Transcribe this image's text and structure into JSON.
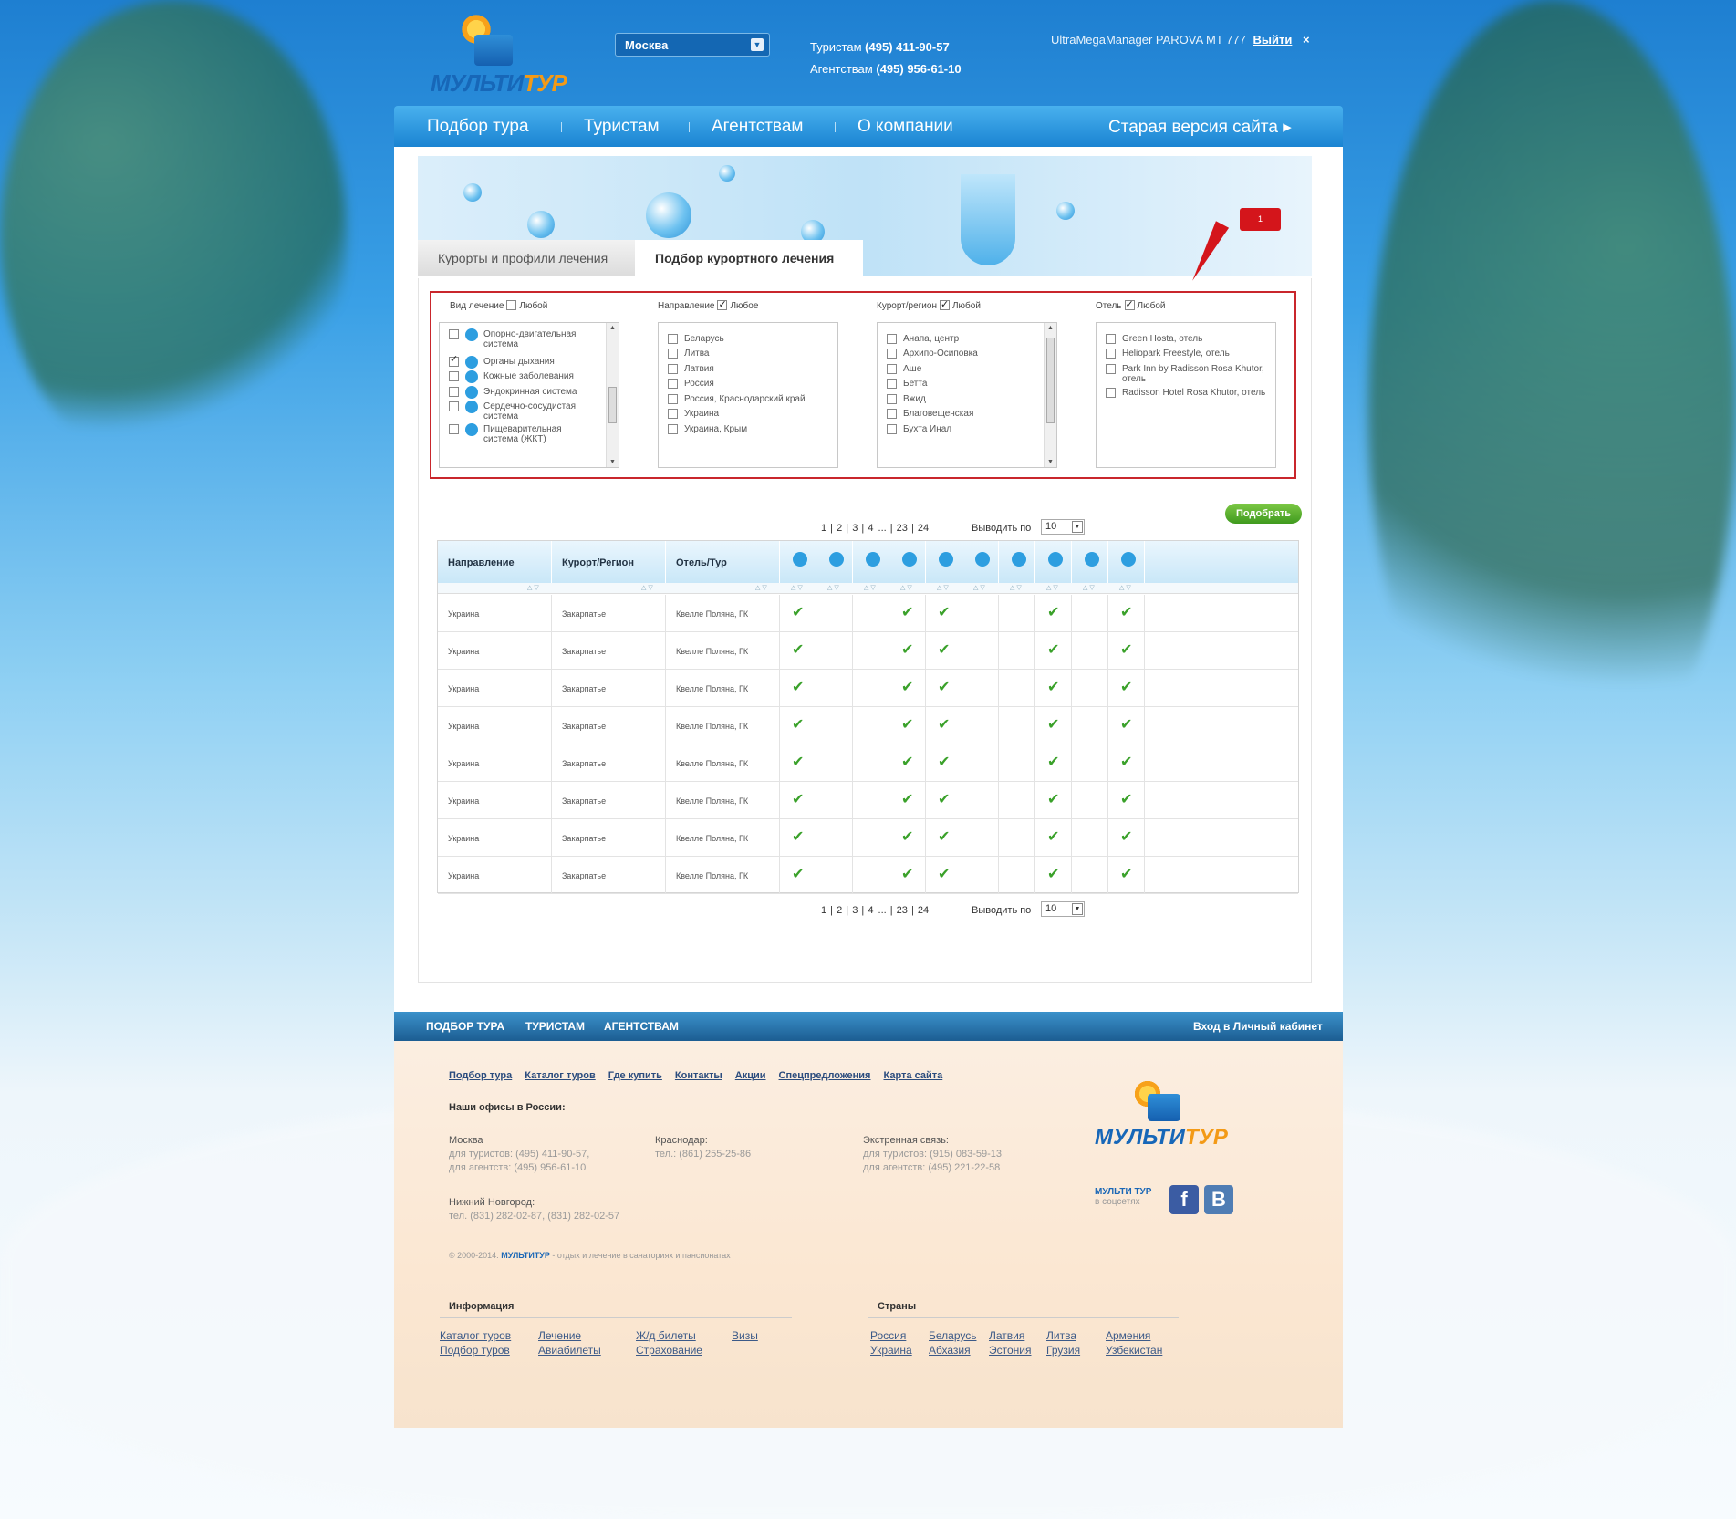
{
  "header": {
    "logo_text_a": "МУЛЬТИ",
    "logo_text_b": "ТУР",
    "city": "Москва",
    "phone_tourists_label": "Туристам",
    "phone_tourists": "(495) 411-90-57",
    "phone_agents_label": "Агентствам",
    "phone_agents": "(495) 956-61-10",
    "user": "UltraMegaManager PAROVA MT 777",
    "logout": "Выйти",
    "close": "×"
  },
  "nav": {
    "items": [
      "Подбор тура",
      "Туристам",
      "Агентствам",
      "О компании"
    ],
    "old_site": "Старая версия сайта ▸"
  },
  "tabs": [
    "Курорты и профили лечения",
    "Подбор курортного лечения"
  ],
  "annotation": "1",
  "filters": {
    "treatment": {
      "label": "Вид лечение",
      "any": "Любой",
      "any_checked": false,
      "items": [
        {
          "text": "Опорно-двигательная система",
          "checked": false
        },
        {
          "text": "Органы дыхания",
          "checked": true
        },
        {
          "text": "Кожные заболевания",
          "checked": false
        },
        {
          "text": "Эндокринная система",
          "checked": false
        },
        {
          "text": "Сердечно-сосудистая система",
          "checked": false
        },
        {
          "text": "Пищеварительная система (ЖКТ)",
          "checked": false
        }
      ]
    },
    "direction": {
      "label": "Направление",
      "any": "Любое",
      "any_checked": true,
      "items": [
        "Беларусь",
        "Литва",
        "Латвия",
        "Россия",
        "Россия, Краснодарский край",
        "Украина",
        "Украина, Крым"
      ]
    },
    "resort": {
      "label": "Курорт/регион",
      "any": "Любой",
      "any_checked": true,
      "items": [
        "Анапа, центр",
        "Архипо-Осиповка",
        "Аше",
        "Бетта",
        "Вжид",
        "Благовещенская",
        "Бухта Инал"
      ]
    },
    "hotel": {
      "label": "Отель",
      "any": "Любой",
      "any_checked": true,
      "items": [
        "Green Hosta, отель",
        "Heliopark Freestyle, отель",
        "Park Inn by Radisson Rosa Khutor, отель",
        "Radisson Hotel Rosa Khutor, отель"
      ]
    }
  },
  "submit": "Подобрать",
  "pager": {
    "pages": [
      "1",
      "2",
      "3",
      "4",
      "...",
      "23",
      "24"
    ],
    "per_page_label": "Выводить по",
    "per_page": "10"
  },
  "table": {
    "columns": [
      "Направление",
      "Курорт/Регион",
      "Отель/Тур"
    ],
    "icon_columns": [
      "search-icon",
      "brain-icon",
      "eye-icon",
      "heart-icon",
      "person-icon",
      "lungs-icon",
      "ph-icon",
      "nerve-icon",
      "liver-icon",
      "stomach-icon"
    ],
    "rows": [
      {
        "direction": "Украина",
        "region": "Закарпатье",
        "hotel": "Квелле Поляна, ГК",
        "marks": [
          1,
          0,
          0,
          1,
          1,
          0,
          0,
          1,
          0,
          1
        ]
      },
      {
        "direction": "Украина",
        "region": "Закарпатье",
        "hotel": "Квелле Поляна, ГК",
        "marks": [
          1,
          0,
          0,
          1,
          1,
          0,
          0,
          1,
          0,
          1
        ]
      },
      {
        "direction": "Украина",
        "region": "Закарпатье",
        "hotel": "Квелле Поляна, ГК",
        "marks": [
          1,
          0,
          0,
          1,
          1,
          0,
          0,
          1,
          0,
          1
        ]
      },
      {
        "direction": "Украина",
        "region": "Закарпатье",
        "hotel": "Квелле Поляна, ГК",
        "marks": [
          1,
          0,
          0,
          1,
          1,
          0,
          0,
          1,
          0,
          1
        ]
      },
      {
        "direction": "Украина",
        "region": "Закарпатье",
        "hotel": "Квелле Поляна, ГК",
        "marks": [
          1,
          0,
          0,
          1,
          1,
          0,
          0,
          1,
          0,
          1
        ]
      },
      {
        "direction": "Украина",
        "region": "Закарпатье",
        "hotel": "Квелле Поляна, ГК",
        "marks": [
          1,
          0,
          0,
          1,
          1,
          0,
          0,
          1,
          0,
          1
        ]
      },
      {
        "direction": "Украина",
        "region": "Закарпатье",
        "hotel": "Квелле Поляна, ГК",
        "marks": [
          1,
          0,
          0,
          1,
          1,
          0,
          0,
          1,
          0,
          1
        ]
      },
      {
        "direction": "Украина",
        "region": "Закарпатье",
        "hotel": "Квелле Поляна, ГК",
        "marks": [
          1,
          0,
          0,
          1,
          1,
          0,
          0,
          1,
          0,
          1
        ]
      }
    ]
  },
  "footer_nav": {
    "items": [
      "ПОДБОР ТУРА",
      "ТУРИСТАМ",
      "АГЕНТСТВАМ"
    ],
    "login": "Вход в Личный кабинет"
  },
  "footer": {
    "links": [
      "Подбор тура",
      "Каталог туров",
      "Где купить",
      "Контакты",
      "Акции",
      "Спецпредложения",
      "Карта сайта"
    ],
    "offices_title": "Наши офисы в России:",
    "moscow": {
      "city": "Москва",
      "l1": "для туристов: (495) 411-90-57,",
      "l2": "для агентств: (495) 956-61-10"
    },
    "krasnodar": {
      "city": "Краснодар:",
      "l1": "тел.: (861) 255-25-86"
    },
    "emergency": {
      "city": "Экстренная связь:",
      "l1": "для туристов: (915) 083-59-13",
      "l2": "для агентств: (495) 221-22-58"
    },
    "nn": {
      "city": "Нижний Новгород:",
      "l1": "тел. (831) 282-02-87, (831) 282-02-57"
    },
    "copyright": "© 2000-2014.",
    "copyright_brand": "МУЛЬТИТУР",
    "copyright_tail": "- отдых и лечение в санаториях и пансионатах",
    "social_brand": "МУЛЬТИ ТУР",
    "social_text": "в соцсетях",
    "fb": "f",
    "vk": "B",
    "info_title": "Информация",
    "info_links": [
      "Каталог туров",
      "Лечение",
      "Ж/д билеты",
      "Визы",
      "Подбор туров",
      "Авиабилеты",
      "Страхование"
    ],
    "countries_title": "Страны",
    "country_links": [
      "Россия",
      "Беларусь",
      "Латвия",
      "Литва",
      "Армения",
      "Украина",
      "Абхазия",
      "Эстония",
      "Грузия",
      "Узбекистан"
    ]
  }
}
